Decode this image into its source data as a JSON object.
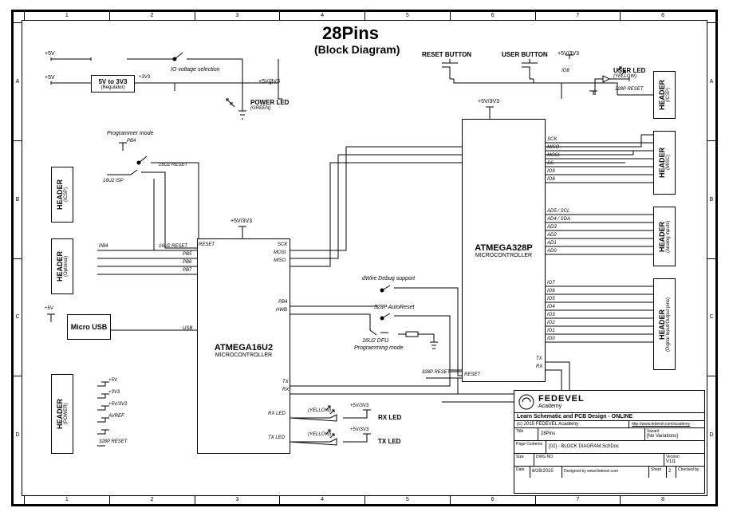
{
  "title": "28Pins",
  "subtitle": "(Block Diagram)",
  "ruler_cols": [
    "1",
    "2",
    "3",
    "4",
    "5",
    "6",
    "7",
    "8"
  ],
  "ruler_rows": [
    "A",
    "B",
    "C",
    "D"
  ],
  "blocks": {
    "reg": {
      "title": "5V to 3V3",
      "sub": "(Regulator)"
    },
    "u1": {
      "title": "ATMEGA16U2",
      "sub": "MICROCONTROLLER"
    },
    "u2": {
      "title": "ATMEGA328P",
      "sub": "MICROCONTROLLER"
    },
    "h_icsp1": {
      "title": "HEADER",
      "sub": "(ICSP)"
    },
    "h_opt": {
      "title": "HEADER",
      "sub": "(Optional)"
    },
    "h_pwr": {
      "title": "HEADER",
      "sub": "(POWER)"
    },
    "h_icsp2": {
      "title": "HEADER",
      "sub": "(ICSP)"
    },
    "h_misc": {
      "title": "HEADER",
      "sub": "(MISC)"
    },
    "h_ana": {
      "title": "HEADER",
      "sub": "(Analog inputs)"
    },
    "h_dig": {
      "title": "HEADER",
      "sub": "(Digital Input/Output pins)"
    },
    "usb": "Micro USB"
  },
  "labels": {
    "io_sel": "IO voltage selection",
    "pwr_led": "POWER LED",
    "pwr_led_sub": "(GREEN)",
    "rst_btn": "RESET BUTTON",
    "usr_btn": "USER BUTTON",
    "usr_led": "USER LED",
    "usr_led_sub": "(YELLOW)",
    "prog_mode": "Programmer mode",
    "dwire": "dWire Debug support",
    "autorst": "328P AutoReset",
    "dfu": "16U2 DFU",
    "dfu2": "Programming mode",
    "isp": "16U2 ISP",
    "rx_led": "RX LED",
    "tx_led": "TX LED",
    "yellow": "(YELLOW)",
    "p5v": "+5V",
    "p3v3": "+3V3",
    "p5v3v3": "+5V/3V3",
    "avref": "AVREF",
    "rst328": "328P RESET",
    "rst16u2": "16U2 RESET"
  },
  "pins_u1_left": [
    "RESET",
    "",
    "",
    "",
    "",
    "",
    "PB4",
    "HWB",
    "",
    "USB",
    "",
    "",
    "",
    "",
    "TX",
    "RX",
    "",
    "",
    "RX LED",
    "",
    "TX LED"
  ],
  "pins_u1_right": [
    "SCK",
    "MOSI",
    "MISO"
  ],
  "pins_u2_left": [
    "",
    "",
    "",
    "",
    "",
    "",
    "",
    "",
    "",
    "",
    "",
    "",
    "",
    "",
    "",
    "",
    "",
    "",
    "",
    "",
    "",
    "",
    "",
    "",
    "",
    "",
    "328P RESET",
    "RESET"
  ],
  "pins_u2_right_misc": [
    "SCK",
    "MISO",
    "MOSI",
    "SS",
    "IO9",
    "IO8"
  ],
  "pins_u2_right_ana": [
    "AD5 / SCL",
    "AD4 / SDA",
    "AD3",
    "AD2",
    "AD1",
    "AD0"
  ],
  "pins_u2_right_dig": [
    "IO7",
    "IO6",
    "IO5",
    "IO4",
    "IO3",
    "IO2",
    "IO1",
    "IO0"
  ],
  "pins_u2_tr": [
    "TX",
    "RX"
  ],
  "pins_opt": [
    "PB4",
    "PB5",
    "PB6",
    "PB7"
  ],
  "titleblock": {
    "brand": "FEDEVEL",
    "brand_sub": "Academy",
    "course": "Learn Schematic and PCB Design - ONLINE",
    "copy": "(c) 2015 FEDEVEL Academy",
    "url": "http://www.fedevel.com/academy",
    "title_lbl": "Title",
    "title_val": "28Pins",
    "variant_lbl": "Variant",
    "variant_val": "[No Variations]",
    "page_lbl": "Page Contents",
    "page_val": "[02] - BLOCK DIAGRAM.SchDoc",
    "size_lbl": "Size",
    "size_val": "",
    "dwg_lbl": "DWG NO",
    "ver_lbl": "Version",
    "ver_val": "V1I1",
    "date_lbl": "Date",
    "date_val": "6/28/2015",
    "designed": "Designed by www.fedevel.com",
    "sheet_lbl": "Sheet",
    "sheet_val": "2",
    "check_lbl": "Checked by"
  }
}
